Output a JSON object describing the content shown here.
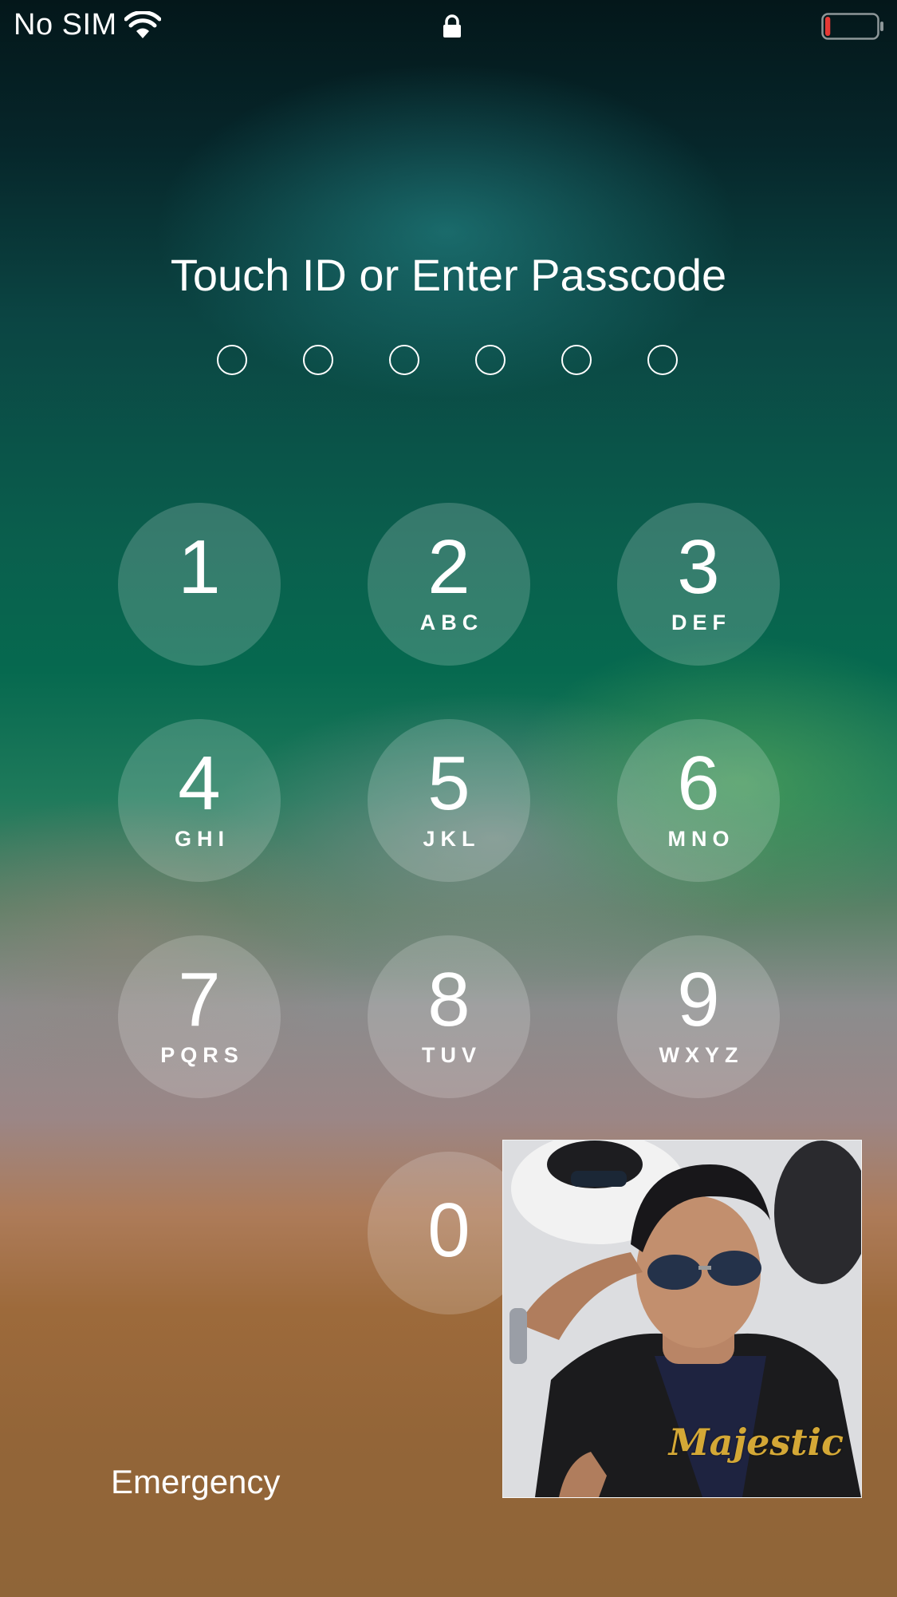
{
  "status_bar": {
    "carrier": "No SIM",
    "battery_level": 0.1,
    "battery_color": "#e53935"
  },
  "title": "Touch ID or Enter Passcode",
  "passcode_length": 6,
  "keypad": [
    {
      "digit": "1",
      "letters": ""
    },
    {
      "digit": "2",
      "letters": "ABC"
    },
    {
      "digit": "3",
      "letters": "DEF"
    },
    {
      "digit": "4",
      "letters": "GHI"
    },
    {
      "digit": "5",
      "letters": "JKL"
    },
    {
      "digit": "6",
      "letters": "MNO"
    },
    {
      "digit": "7",
      "letters": "PQRS"
    },
    {
      "digit": "8",
      "letters": "TUV"
    },
    {
      "digit": "9",
      "letters": "WXYZ"
    },
    {
      "digit": "0",
      "letters": ""
    }
  ],
  "emergency_label": "Emergency",
  "photo_overlay": {
    "watermark": "Majestic"
  }
}
